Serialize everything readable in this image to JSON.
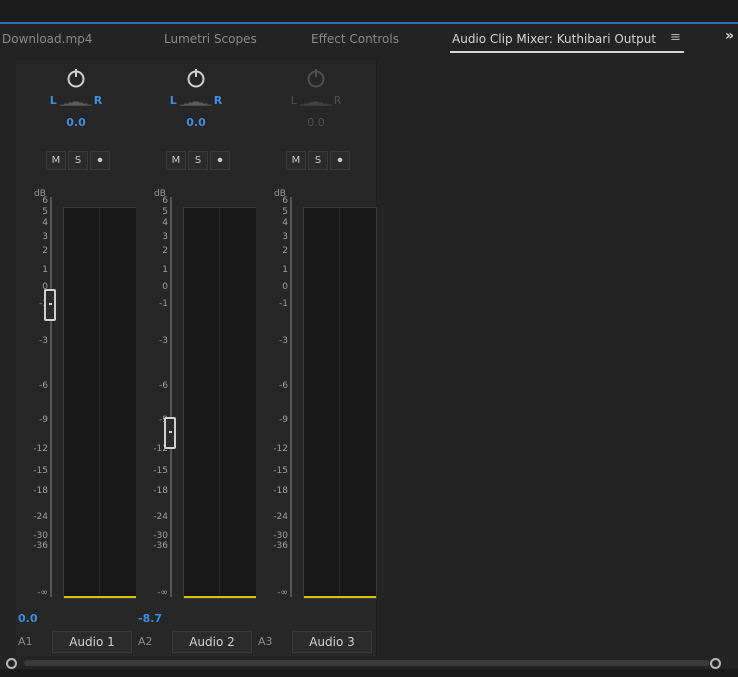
{
  "tabs": [
    {
      "label": "Download.mp4",
      "active": false
    },
    {
      "label": "Lumetri Scopes",
      "active": false
    },
    {
      "label": "Effect Controls",
      "active": false
    },
    {
      "label": "Audio Clip Mixer: Kuthibari Output",
      "active": true
    }
  ],
  "panel_menu_icon": "hamburger-menu-icon",
  "overflow_icon": "double-chevron-right-icon",
  "channels": [
    {
      "pan_left": "L",
      "pan_right": "R",
      "pan_value": "0.0",
      "buttons": [
        "M",
        "S",
        "⏺"
      ],
      "db_label": "dB",
      "scale": [
        "6",
        "5",
        "4",
        "3",
        "2",
        "1",
        "0",
        "-1",
        "-3",
        "-6",
        "-9",
        "-12",
        "-15",
        "-18",
        "-24",
        "-30",
        "-36",
        "-∞"
      ],
      "volume": "0.0",
      "fader_level_db": 0,
      "track_id": "A1",
      "track_name": "Audio 1",
      "enabled": true
    },
    {
      "pan_left": "L",
      "pan_right": "R",
      "pan_value": "0.0",
      "buttons": [
        "M",
        "S",
        "⏺"
      ],
      "db_label": "dB",
      "scale": [
        "6",
        "5",
        "4",
        "3",
        "2",
        "1",
        "0",
        "-1",
        "-3",
        "-6",
        "-9",
        "-12",
        "-15",
        "-18",
        "-24",
        "-30",
        "-36",
        "-∞"
      ],
      "volume": "-8.7",
      "fader_level_db": -8.7,
      "track_id": "A2",
      "track_name": "Audio 2",
      "enabled": true
    },
    {
      "pan_left": "L",
      "pan_right": "R",
      "pan_value": "0.0",
      "buttons": [
        "M",
        "S",
        "⏺"
      ],
      "db_label": "dB",
      "scale": [
        "6",
        "5",
        "4",
        "3",
        "2",
        "1",
        "0",
        "-1",
        "-3",
        "-6",
        "-9",
        "-12",
        "-15",
        "-18",
        "-24",
        "-30",
        "-36",
        "-∞"
      ],
      "volume": "",
      "fader_level_db": null,
      "track_id": "A3",
      "track_name": "Audio 3",
      "enabled": false
    }
  ],
  "colors": {
    "accent": "#3d8ddd",
    "meter_base": "#d9c200",
    "tab_underline": "#d6d6d6"
  }
}
